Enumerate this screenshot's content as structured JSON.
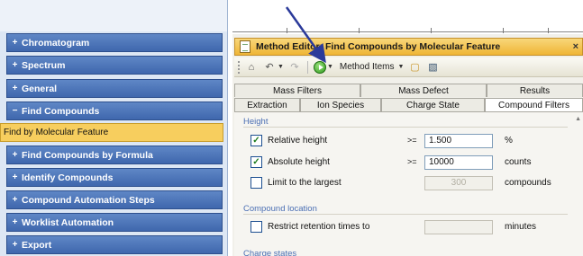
{
  "nav": {
    "items": [
      {
        "sign": "+",
        "label": "Chromatogram"
      },
      {
        "sign": "+",
        "label": "Spectrum"
      },
      {
        "sign": "+",
        "label": "General"
      },
      {
        "sign": "−",
        "label": "Find Compounds"
      },
      {
        "sign": "+",
        "label": "Find Compounds by Formula"
      },
      {
        "sign": "+",
        "label": "Identify Compounds"
      },
      {
        "sign": "+",
        "label": "Compound Automation Steps"
      },
      {
        "sign": "+",
        "label": "Worklist Automation"
      },
      {
        "sign": "+",
        "label": "Export"
      }
    ],
    "selected_subitem": "Find by Molecular Feature"
  },
  "window": {
    "title": "Method Editor: Find Compounds by Molecular Feature",
    "close": "×",
    "toolbar": {
      "method_items": "Method Items"
    }
  },
  "tabs": {
    "row1": [
      "Mass Filters",
      "Mass Defect",
      "Results"
    ],
    "row2": [
      "Extraction",
      "Ion Species",
      "Charge State",
      "Compound Filters"
    ],
    "active": "Compound Filters"
  },
  "panel": {
    "height_section": "Height",
    "relative_height": {
      "label": "Relative height",
      "checked": true,
      "op": ">=",
      "value": "1.500",
      "unit": "%"
    },
    "absolute_height": {
      "label": "Absolute height",
      "checked": true,
      "op": ">=",
      "value": "10000",
      "unit": "counts"
    },
    "limit_largest": {
      "label": "Limit to the largest",
      "checked": false,
      "value": "300",
      "unit": "compounds"
    },
    "location_section": "Compound location",
    "restrict_rt": {
      "label": "Restrict retention times to",
      "checked": false,
      "unit": "minutes"
    },
    "charge_section": "Charge states"
  }
}
